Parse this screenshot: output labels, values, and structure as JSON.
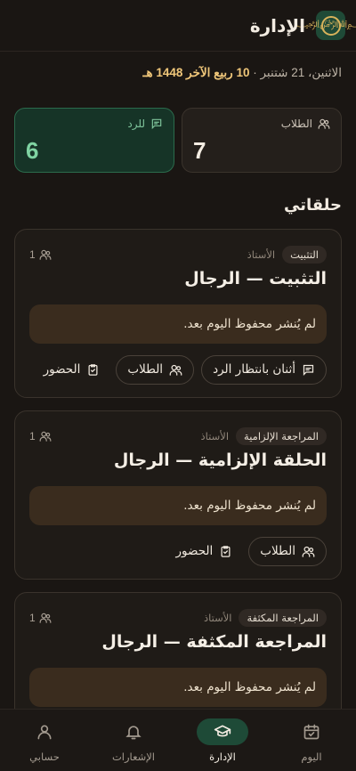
{
  "header": {
    "title": "الإدارة",
    "logo_glyph": "﷽"
  },
  "date": {
    "gregorian": "الاثنين، 21 شتنبر",
    "separator": " · ",
    "hijri": "10 ربيع الآخر 1448 هـ"
  },
  "stats": {
    "students": {
      "label": "الطلاب",
      "value": "7",
      "icon": "users-icon"
    },
    "pending": {
      "label": "للرد",
      "value": "6",
      "icon": "message-icon"
    }
  },
  "section": {
    "title": "حلقاتي"
  },
  "teacher_label": "الأستاذ",
  "cards": [
    {
      "tag": "التثبيت",
      "count": "1",
      "title": "التثبيت — الرجال",
      "notice": "لم يُنشر محفوظ اليوم بعد.",
      "actions": {
        "pending": "أثنان بانتظار الرد",
        "students": "الطلاب",
        "attendance": "الحضور"
      }
    },
    {
      "tag": "المراجعة الإلزامية",
      "count": "1",
      "title": "الحلقة الإلزامية — الرجال",
      "notice": "لم يُنشر محفوظ اليوم بعد.",
      "actions": {
        "students": "الطلاب",
        "attendance": "الحضور"
      }
    },
    {
      "tag": "المراجعة المكثفة",
      "count": "1",
      "title": "المراجعة المكثفة — الرجال",
      "notice": "لم يُنشر محفوظ اليوم بعد."
    }
  ],
  "nav": [
    {
      "label": "اليوم",
      "icon": "calendar-icon",
      "active": false
    },
    {
      "label": "الإدارة",
      "icon": "graduation-cap-icon",
      "active": true
    },
    {
      "label": "الإشعارات",
      "icon": "bell-icon",
      "active": false
    },
    {
      "label": "حسابي",
      "icon": "user-icon",
      "active": false
    }
  ],
  "colors": {
    "background": "#1a1613",
    "accent_green": "#1e4a37",
    "hijri_gold": "#f0c77a",
    "notice_bg": "#3a2c1e"
  }
}
